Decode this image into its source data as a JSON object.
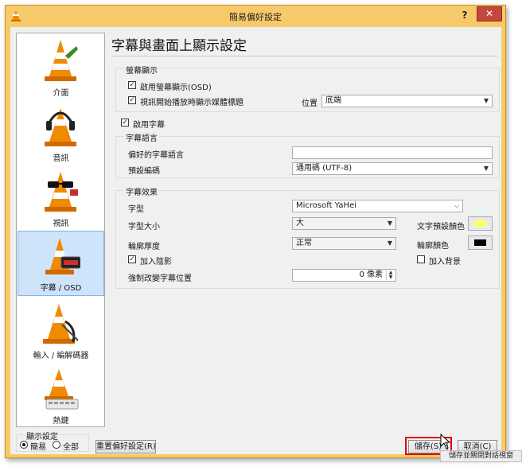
{
  "window": {
    "title": "簡易偏好設定",
    "help_label": "?",
    "close_label": "✕"
  },
  "sidebar": {
    "categories": [
      {
        "label": "介面",
        "icon": "vlc-cone-interface-icon"
      },
      {
        "label": "音訊",
        "icon": "vlc-cone-headphones-icon"
      },
      {
        "label": "視訊",
        "icon": "vlc-cone-glasses-icon"
      },
      {
        "label": "字幕 / OSD",
        "icon": "vlc-cone-subtitle-icon",
        "selected": true
      },
      {
        "label": "輸入 / 編解碼器",
        "icon": "vlc-cone-cables-icon"
      },
      {
        "label": "熱鍵",
        "icon": "vlc-cone-keyboard-icon"
      }
    ]
  },
  "panel": {
    "title": "字幕與畫面上顯示設定",
    "osd_group": {
      "legend": "螢幕顯示",
      "enable_osd": {
        "label": "啟用螢幕顯示(OSD)",
        "checked": true
      },
      "show_title": {
        "label": "視訊開始播放時顯示媒體標題",
        "checked": true
      },
      "position_label": "位置",
      "position_value": "底端"
    },
    "enable_subtitles": {
      "label": "啟用字幕",
      "checked": true
    },
    "lang_group": {
      "legend": "字幕語言",
      "preferred_label": "偏好的字幕語言",
      "preferred_value": "",
      "encoding_label": "預設編碼",
      "encoding_value": "通用碼 (UTF-8)"
    },
    "effects_group": {
      "legend": "字幕效果",
      "font_label": "字型",
      "font_value": "Microsoft YaHei",
      "size_label": "字型大小",
      "size_value": "大",
      "text_color_label": "文字預設顏色",
      "text_color": "#ffff66",
      "outline_label": "輪廓厚度",
      "outline_value": "正常",
      "outline_color_label": "輪廓顏色",
      "outline_color": "#000000",
      "shadow": {
        "label": "加入陰影",
        "checked": true
      },
      "background": {
        "label": "加入背景",
        "checked": false
      },
      "force_pos_label": "強制改變字幕位置",
      "force_pos_value": "0 像素"
    }
  },
  "footer": {
    "show_settings_legend": "顯示設定",
    "simple_label": "簡易",
    "all_label": "全部",
    "reset_label": "重置偏好設定(R)",
    "save_label": "儲存(S)",
    "cancel_label": "取消(C)"
  },
  "caption": "儲存並關閉對話視窗",
  "colors": {
    "window_frame": "#f6ca6a",
    "close_button": "#c7463c",
    "highlight": "#e00000",
    "selection": "#cde4fb"
  }
}
